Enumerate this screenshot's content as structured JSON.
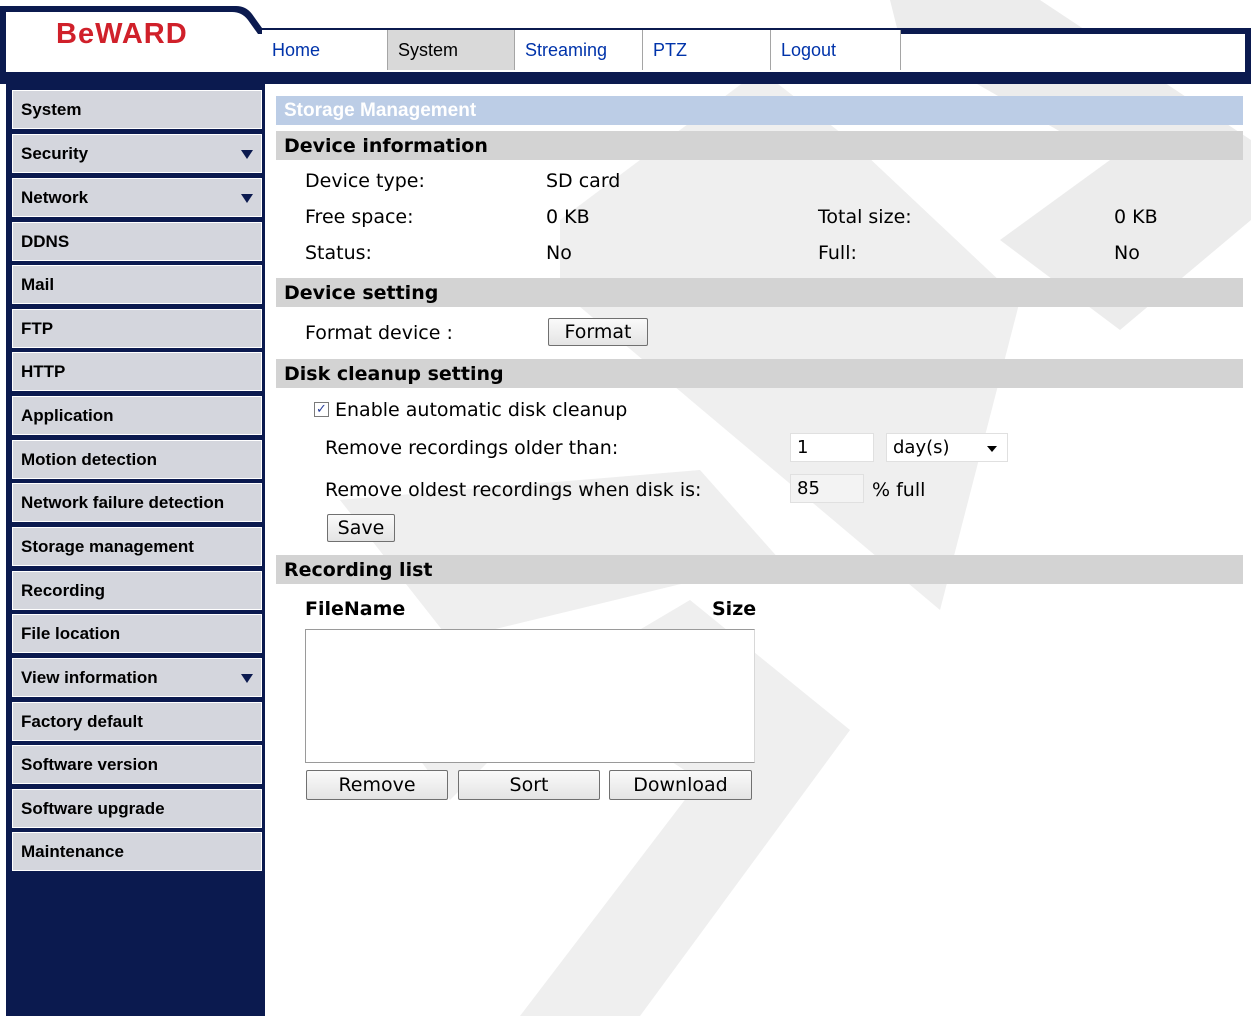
{
  "brand": {
    "logo": "BeWARD"
  },
  "nav": {
    "tabs": [
      {
        "label": "Home"
      },
      {
        "label": "System"
      },
      {
        "label": "Streaming"
      },
      {
        "label": "PTZ"
      },
      {
        "label": "Logout"
      }
    ]
  },
  "sidebar": {
    "items": [
      {
        "label": "System",
        "has_submenu": false
      },
      {
        "label": "Security",
        "has_submenu": true
      },
      {
        "label": "Network",
        "has_submenu": true
      },
      {
        "label": "DDNS",
        "has_submenu": false
      },
      {
        "label": "Mail",
        "has_submenu": false
      },
      {
        "label": "FTP",
        "has_submenu": false
      },
      {
        "label": "HTTP",
        "has_submenu": false
      },
      {
        "label": "Application",
        "has_submenu": false
      },
      {
        "label": "Motion detection",
        "has_submenu": false
      },
      {
        "label": "Network failure detection",
        "has_submenu": false
      },
      {
        "label": "Storage management",
        "has_submenu": false
      },
      {
        "label": "Recording",
        "has_submenu": false
      },
      {
        "label": "File location",
        "has_submenu": false
      },
      {
        "label": "View information",
        "has_submenu": true
      },
      {
        "label": "Factory default",
        "has_submenu": false
      },
      {
        "label": "Software version",
        "has_submenu": false
      },
      {
        "label": "Software upgrade",
        "has_submenu": false
      },
      {
        "label": "Maintenance",
        "has_submenu": false
      }
    ]
  },
  "page": {
    "title": "Storage Management"
  },
  "device_info": {
    "heading": "Device information",
    "device_type_label": "Device type:",
    "device_type_value": "SD card",
    "free_space_label": "Free space:",
    "free_space_value": "0 KB",
    "total_size_label": "Total size:",
    "total_size_value": "0 KB",
    "status_label": "Status:",
    "status_value": "No",
    "full_label": "Full:",
    "full_value": "No"
  },
  "device_setting": {
    "heading": "Device setting",
    "format_label": "Format device :",
    "format_button": "Format"
  },
  "disk_cleanup": {
    "heading": "Disk cleanup setting",
    "enable_label": "Enable automatic disk cleanup",
    "enable_checked": true,
    "older_than_label": "Remove recordings older than:",
    "older_than_value": "1",
    "older_than_unit": "day(s)",
    "when_full_label": "Remove oldest recordings when disk is:",
    "when_full_value": "85",
    "when_full_unit": "% full",
    "save_button": "Save"
  },
  "recording_list": {
    "heading": "Recording list",
    "col_filename": "FileName",
    "col_size": "Size",
    "remove_button": "Remove",
    "sort_button": "Sort",
    "download_button": "Download"
  },
  "colors": {
    "navy": "#0b1a4f",
    "logo_red": "#d0202a",
    "link_blue": "#0033aa",
    "title_bar": "#bccde6",
    "section_bar": "#d3d3d3",
    "menu_item": "#d4d6dd"
  }
}
